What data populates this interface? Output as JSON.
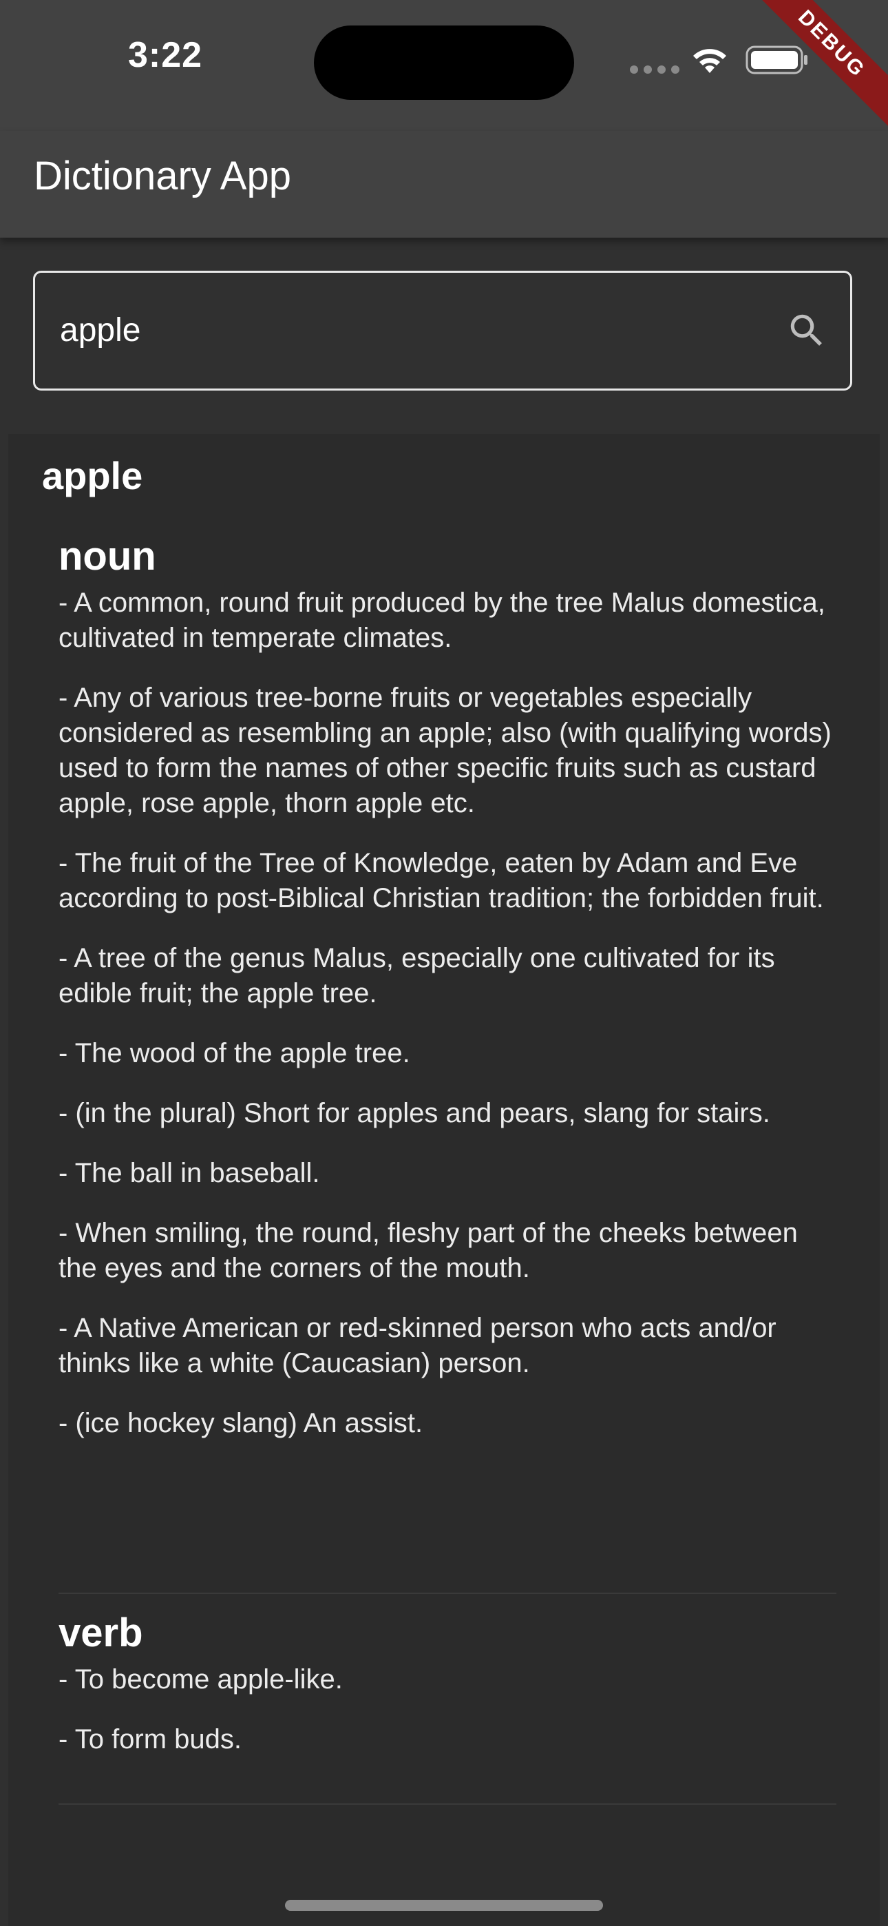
{
  "status_bar": {
    "time": "3:22",
    "icons": [
      "signal-dots-icon",
      "wifi-icon",
      "battery-icon"
    ],
    "debug_banner": "DEBUG"
  },
  "app_bar": {
    "title": "Dictionary App"
  },
  "search": {
    "value": "apple",
    "icon": "search-icon"
  },
  "result": {
    "word": "apple",
    "meanings": [
      {
        "part_of_speech": "noun",
        "definitions": [
          "- A common, round fruit produced by the tree Malus domestica, cultivated in temperate climates.",
          "- Any of various tree-borne fruits or vegetables especially considered as resembling an apple; also (with qualifying words) used to form the names of other specific fruits such as custard apple, rose apple, thorn apple etc.",
          "- The fruit of the Tree of Knowledge, eaten by Adam and Eve according to post-Biblical Christian tradition; the forbidden fruit.",
          "- A tree of the genus Malus, especially one cultivated for its edible fruit; the apple tree.",
          "- The wood of the apple tree.",
          "- (in the plural) Short for apples and pears, slang for stairs.",
          "- The ball in baseball.",
          "- When smiling, the round, fleshy part of the cheeks between the eyes and the corners of the mouth.",
          "- A Native American or red-skinned person who acts and/or thinks like a white (Caucasian) person.",
          "- (ice hockey slang) An assist."
        ]
      },
      {
        "part_of_speech": "verb",
        "definitions": [
          "- To become apple-like.",
          "- To form buds."
        ]
      }
    ]
  },
  "colors": {
    "app_bar": "#424242",
    "background": "#303030",
    "card": "#2b2b2b",
    "debug_banner": "#8b1a1a"
  }
}
